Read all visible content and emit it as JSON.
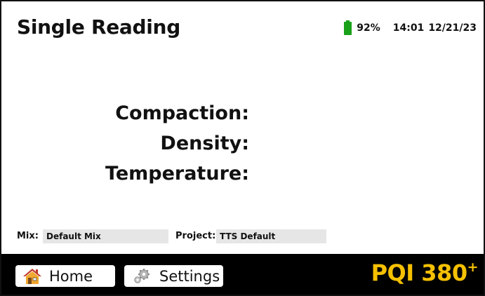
{
  "header": {
    "title": "Single Reading",
    "battery_percent": "92%",
    "battery_color": "#1aa11a",
    "time": "14:01",
    "date": "12/21/23"
  },
  "readings": {
    "compaction_label": "Compaction:",
    "density_label": "Density:",
    "temperature_label": "Temperature:"
  },
  "meta": {
    "mix_label": "Mix:",
    "mix_value": "Default Mix",
    "project_label": "Project:",
    "project_value": "TTS Default"
  },
  "footer": {
    "home_label": "Home",
    "home_icon": "home-icon",
    "settings_label": "Settings",
    "settings_icon": "gears-icon",
    "brand_name": "PQI 380",
    "brand_mark": "+",
    "brand_color": "#f5c000"
  }
}
